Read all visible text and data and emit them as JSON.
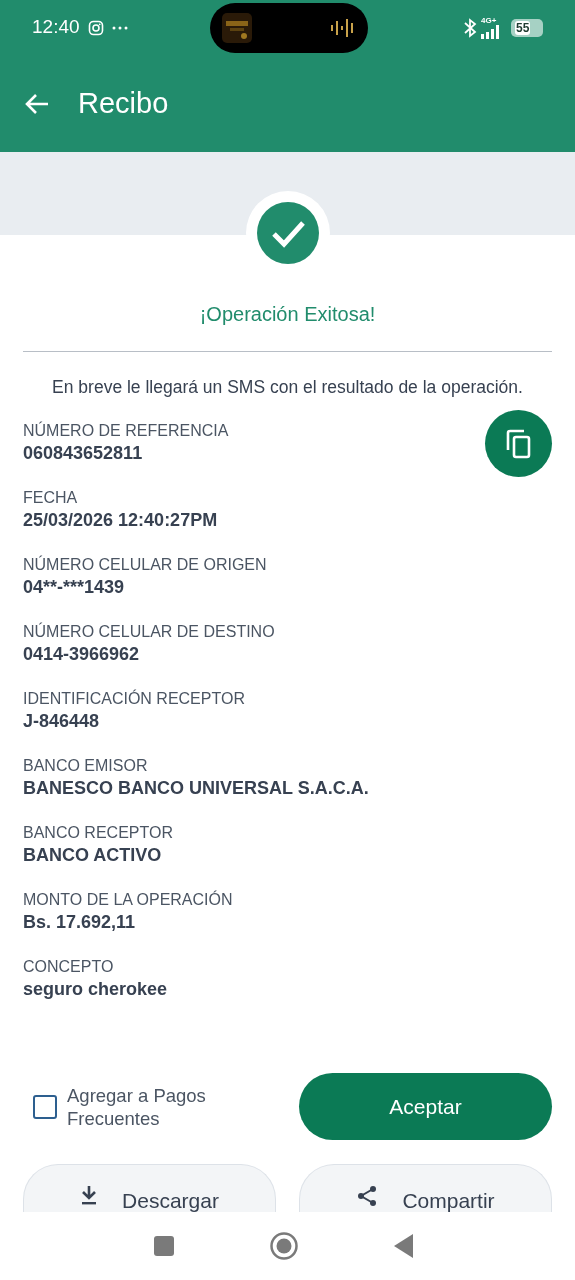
{
  "status_bar": {
    "time": "12:40",
    "network": "4G+",
    "battery": "55"
  },
  "app_bar": {
    "title": "Recibo"
  },
  "result": {
    "title": "¡Operación Exitosa!",
    "message": "En breve le llegará un SMS con el resultado de la operación."
  },
  "fields": [
    {
      "label": "NÚMERO DE REFERENCIA",
      "value": "060843652811"
    },
    {
      "label": "FECHA",
      "value": "25/03/2026 12:40:27PM"
    },
    {
      "label": "NÚMERO CELULAR DE ORIGEN",
      "value": "04**-***1439"
    },
    {
      "label": "NÚMERO CELULAR DE DESTINO",
      "value": "0414-3966962"
    },
    {
      "label": "IDENTIFICACIÓN RECEPTOR",
      "value": "J-846448"
    },
    {
      "label": "BANCO EMISOR",
      "value": "BANESCO BANCO UNIVERSAL S.A.C.A."
    },
    {
      "label": "BANCO RECEPTOR",
      "value": "BANCO ACTIVO"
    },
    {
      "label": "MONTO DE LA OPERACIÓN",
      "value": "Bs. 17.692,11"
    },
    {
      "label": "CONCEPTO",
      "value": "seguro cherokee"
    }
  ],
  "frequent_payments": {
    "label": "Agregar a Pagos Frecuentes",
    "checked": false
  },
  "buttons": [
    {
      "label": "Aceptar",
      "kind": "primary"
    },
    {
      "label": "Descargar",
      "kind": "download"
    },
    {
      "label": "Compartir",
      "kind": "share"
    }
  ]
}
